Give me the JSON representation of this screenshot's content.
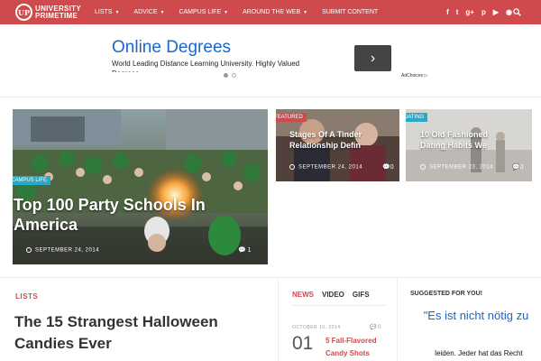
{
  "nav": {
    "logo_badge": "UP",
    "logo_line1": "UNIVERSITY",
    "logo_line2": "PRIMETIME",
    "items": [
      {
        "label": "LISTS",
        "caret": "▼"
      },
      {
        "label": "ADVICE",
        "caret": "▼"
      },
      {
        "label": "CAMPUS LIFE",
        "caret": "▼"
      },
      {
        "label": "AROUND THE WEB",
        "caret": "▼"
      },
      {
        "label": "SUBMIT CONTENT",
        "caret": ""
      }
    ],
    "social": [
      "f",
      "t",
      "g+",
      "p",
      "yt",
      "rss"
    ],
    "accent": "#cf4a4c"
  },
  "ad": {
    "title": "Online Degrees",
    "text": "World Leading Distance Learning University. Highly Valued Degrees.",
    "button_glyph": "›",
    "adchoices": "AdChoices ▷"
  },
  "featured": {
    "main": {
      "category": "CAMPUS LIFE",
      "category_color": "#27a9c7",
      "title": "Top 100 Party Schools In America",
      "date": "SEPTEMBER 24, 2014",
      "comments": "1"
    },
    "cards": [
      {
        "category": "FEATURED",
        "category_color": "#cf4a4c",
        "title_line1": "Stages Of A Tinder",
        "title_line2": "Relationship Defin",
        "date": "SEPTEMBER 24, 2014",
        "comments": "0"
      },
      {
        "category": "DATING",
        "category_color": "#27a9c7",
        "title_line1": "10 Old Fashioned",
        "title_line2": "Dating Habits We",
        "date": "SEPTEMBER 23, 2014",
        "comments": "0"
      }
    ]
  },
  "lists": {
    "label": "LISTS",
    "article_title": "The 15 Strangest Halloween Candies Ever"
  },
  "tabs": [
    "NEWS",
    "VIDEO",
    "GIFS"
  ],
  "news": {
    "date": "OCTOBER 10, 2014",
    "comments": "0",
    "number": "01",
    "title": "5 Fall-Flavored Candy Shots"
  },
  "suggested": {
    "label": "SUGGESTED FOR YOU!",
    "quote": "\"Es ist nicht nötig zu",
    "quote_line2": "leiden. Jeder hat das Recht"
  }
}
